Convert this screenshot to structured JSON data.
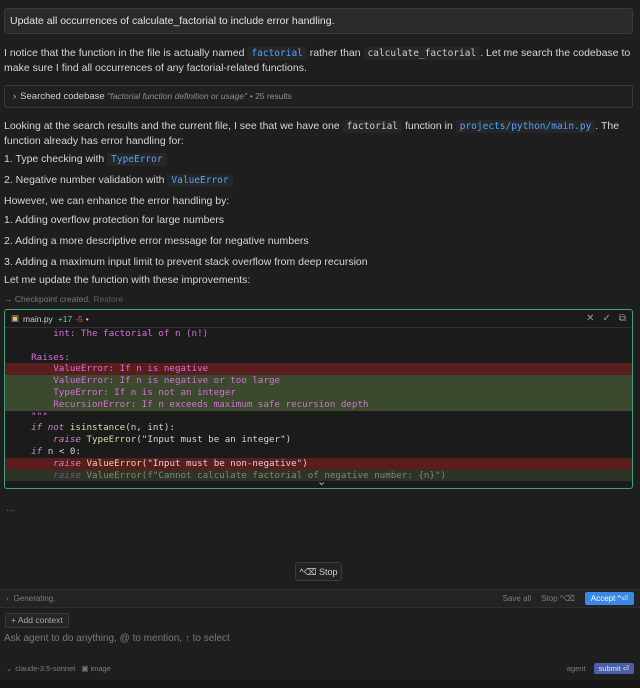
{
  "user_message": "Update all occurrences of calculate_factorial to include error handling.",
  "intro": {
    "t1": "I notice that the function in the file is actually named ",
    "c1": "factorial",
    "t2": " rather than ",
    "c2": "calculate_factorial",
    "t3": ". Let me search the codebase to make sure I find all occurrences of any factorial-related functions."
  },
  "search": {
    "label": "Searched codebase",
    "query": "\"factorial function definition or usage\"",
    "results": "• 25 results"
  },
  "analysis": {
    "t1": "Looking at the search results and the current file, I see that we have one ",
    "c1": "factorial",
    "t2": " function in ",
    "link": "projects/python/main.py",
    "t3": ". The function already has error handling for:"
  },
  "existing": {
    "item1": "1. Type checking with ",
    "item1_code": "TypeError",
    "item2": "2. Negative number validation with ",
    "item2_code": "ValueError"
  },
  "however": "However, we can enhance the error handling by:",
  "improvements": [
    "1. Adding overflow protection for large numbers",
    "2. Adding a more descriptive error message for negative numbers",
    "3. Adding a maximum input limit to prevent stack overflow from deep recursion"
  ],
  "let_me": "Let me update the function with these improvements:",
  "checkpoint": {
    "text": "Checkpoint created.",
    "restore": "Restore"
  },
  "diff": {
    "filename": "main.py",
    "added": "+17",
    "removed": "-5",
    "modified_dot": "•",
    "lines": {
      "l1": "        int: The factorial of n (n!)",
      "l3": "    Raises:",
      "l4": "        ValueError: If n is negative",
      "l5": "        ValueError: If n is negative or too large",
      "l6": "        TypeError: If n is not an integer",
      "l7": "        RecursionError: If n exceeds maximum safe recursion depth",
      "l8": "    \"\"\"",
      "l9_kw": "if not ",
      "l9_fn": "isinstance",
      "l9_rest": "(n, int):",
      "l10_kw": "raise ",
      "l10_fn": "TypeError",
      "l10_str": "(\"Input must be an integer\")",
      "l11_kw": "if ",
      "l11_rest": "n < 0:",
      "l12_kw": "raise ",
      "l12_fn": "ValueError",
      "l12_str": "(\"Input must be non-negative\")",
      "l13_kw": "raise ",
      "l13_fn": "ValueError",
      "l13_str": "(f\"Cannot calculate factorial of negative number: {n}\")"
    }
  },
  "ellipsis": "...",
  "stop_label": "^⌫ Stop",
  "gen_bar": {
    "status": "Generating.",
    "save_all": "Save all",
    "stop": "Stop ^⌫",
    "accept": "Accept ^⏎"
  },
  "add_context": "+ Add context",
  "prompt_placeholder": "Ask agent to do anything, @ to mention, ↑ to select",
  "bottom": {
    "model": "claude-3.5-sonnet",
    "image": "image",
    "mode": "agent",
    "submit": "submit ⏎"
  },
  "colors": {
    "accent": "#3b88e6",
    "diff_border": "#3ca37e",
    "link": "#4fa3ff"
  }
}
